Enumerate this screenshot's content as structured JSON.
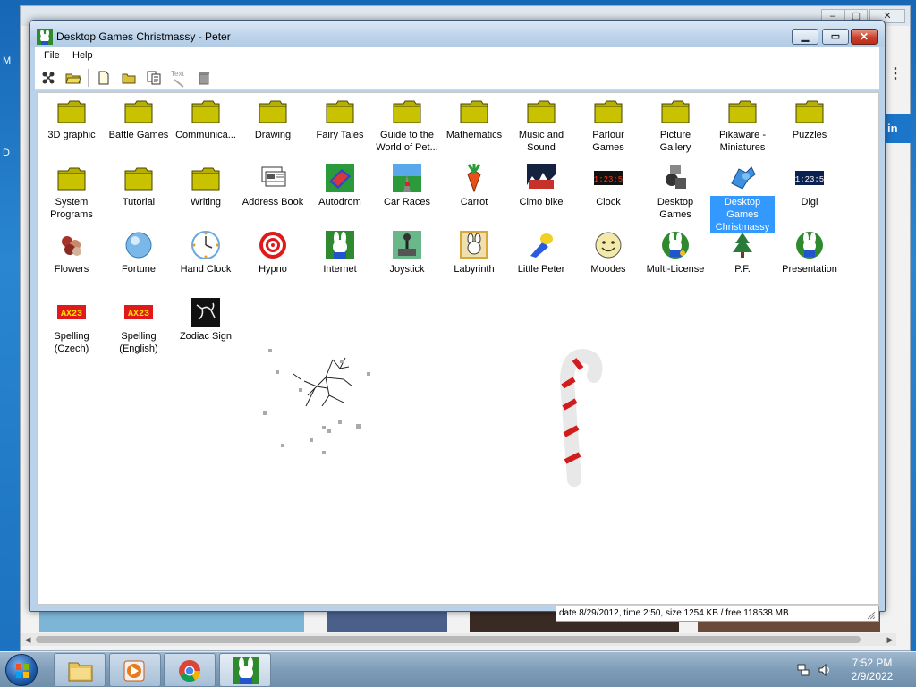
{
  "window": {
    "title": "Desktop Games Christmassy - Peter",
    "menu": [
      "File",
      "Help"
    ]
  },
  "toolbar": {
    "tools": [
      "properties",
      "open",
      "new",
      "new-folder",
      "copy",
      "rename",
      "delete"
    ],
    "rename_label": "Text"
  },
  "icons": [
    {
      "label": "3D graphic",
      "type": "folder"
    },
    {
      "label": "Battle Games",
      "type": "folder"
    },
    {
      "label": "Communica...",
      "type": "folder"
    },
    {
      "label": "Drawing",
      "type": "folder"
    },
    {
      "label": "Fairy Tales",
      "type": "folder"
    },
    {
      "label": "Guide to the World of Pet...",
      "type": "folder"
    },
    {
      "label": "Mathematics",
      "type": "folder"
    },
    {
      "label": "Music and Sound",
      "type": "folder"
    },
    {
      "label": "Parlour Games",
      "type": "folder"
    },
    {
      "label": "Picture Gallery",
      "type": "folder"
    },
    {
      "label": "Pikaware - Miniatures",
      "type": "folder"
    },
    {
      "label": "Puzzles",
      "type": "folder"
    },
    {
      "label": "System Programs",
      "type": "folder"
    },
    {
      "label": "Tutorial",
      "type": "folder"
    },
    {
      "label": "Writing",
      "type": "folder"
    },
    {
      "label": "Address Book",
      "type": "address-book-icon"
    },
    {
      "label": "Autodrom",
      "type": "autodrom-icon"
    },
    {
      "label": "Car Races",
      "type": "car-races-icon"
    },
    {
      "label": "Carrot",
      "type": "carrot-icon"
    },
    {
      "label": "Cimo bike",
      "type": "cimo-bike-icon"
    },
    {
      "label": "Clock",
      "type": "clock-icon",
      "readout": "11:23:51"
    },
    {
      "label": "Desktop Games",
      "type": "desktop-games-icon"
    },
    {
      "label": "Desktop Games Christmassy",
      "type": "desktop-games-christmassy-icon",
      "selected": true
    },
    {
      "label": "Digi",
      "type": "digi-icon",
      "readout": "11:23:51"
    },
    {
      "label": "Flowers",
      "type": "flowers-icon"
    },
    {
      "label": "Fortune",
      "type": "fortune-icon"
    },
    {
      "label": "Hand Clock",
      "type": "hand-clock-icon"
    },
    {
      "label": "Hypno",
      "type": "hypno-icon"
    },
    {
      "label": "Internet",
      "type": "internet-icon"
    },
    {
      "label": "Joystick",
      "type": "joystick-icon"
    },
    {
      "label": "Labyrinth",
      "type": "labyrinth-icon"
    },
    {
      "label": "Little Peter",
      "type": "little-peter-icon"
    },
    {
      "label": "Moodes",
      "type": "moodes-icon"
    },
    {
      "label": "Multi-License",
      "type": "multi-license-icon"
    },
    {
      "label": "P.F.",
      "type": "pf-tree-icon"
    },
    {
      "label": "Presentation",
      "type": "presentation-icon"
    },
    {
      "label": "Spelling (Czech)",
      "type": "spelling-icon",
      "badge": "AX23"
    },
    {
      "label": "Spelling (English)",
      "type": "spelling-icon",
      "badge": "AX23"
    },
    {
      "label": "Zodiac Sign",
      "type": "zodiac-icon"
    }
  ],
  "status": {
    "text": "date 8/29/2012, time 2:50, size 1254 KB / free 118538 MB"
  },
  "taskbar": {
    "buttons": [
      "file-explorer",
      "media-player",
      "chrome",
      "desktop-games-christmassy"
    ],
    "time": "7:52 PM",
    "date": "2/9/2022"
  },
  "background": {
    "tab_letter": "in",
    "side_letters": [
      "M",
      "D"
    ]
  },
  "colors": {
    "folder": "#b8b000",
    "selection": "#3399ff",
    "close_button": "#c7402b"
  }
}
